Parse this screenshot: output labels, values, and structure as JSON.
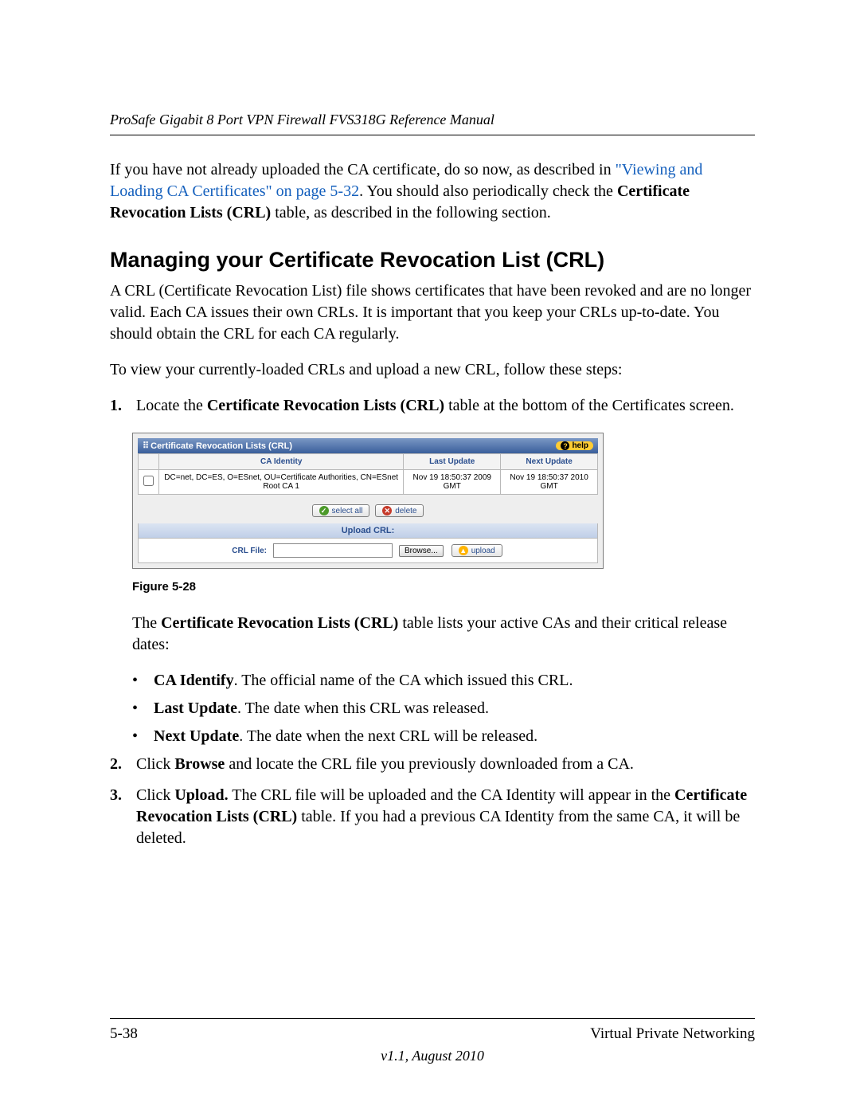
{
  "header": {
    "running": "ProSafe Gigabit 8 Port VPN Firewall FVS318G Reference Manual"
  },
  "para1": {
    "pre": "If you have not already uploaded the CA certificate, do so now, as described in ",
    "link": "\"Viewing and Loading CA Certificates\" on page 5-32",
    "post": ". You should also periodically check the ",
    "bold": "Certificate Revocation Lists (CRL)",
    "tail": " table, as described in the following section."
  },
  "heading": "Managing your Certificate Revocation List (CRL)",
  "para2": "A CRL (Certificate Revocation List) file shows certificates that have been revoked and are no longer valid. Each CA issues their own CRLs. It is important that you keep your CRLs up-to-date. You should obtain the CRL for each CA regularly.",
  "para3": "To view your currently-loaded CRLs and upload a new CRL, follow these steps:",
  "step1": {
    "num": "1.",
    "pre": "Locate the ",
    "bold": "Certificate Revocation Lists (CRL)",
    "post": " table at the bottom of the Certificates screen."
  },
  "figure": {
    "panel_title": "Certificate Revocation Lists (CRL)",
    "help": "help",
    "cols": {
      "ca": "CA Identity",
      "last": "Last Update",
      "next": "Next Update"
    },
    "row": {
      "ca": "DC=net, DC=ES, O=ESnet, OU=Certificate Authorities, CN=ESnet Root CA 1",
      "last": "Nov 19 18:50:37 2009 GMT",
      "next": "Nov 19 18:50:37 2010 GMT"
    },
    "btn_select_all": "select all",
    "btn_delete": "delete",
    "upload_header": "Upload CRL:",
    "crl_file_label": "CRL File:",
    "browse": "Browse...",
    "upload": "upload"
  },
  "caption": "Figure 5-28",
  "para4": {
    "pre": "The ",
    "bold": "Certificate Revocation Lists (CRL)",
    "post": " table lists your active CAs and their critical release dates:"
  },
  "bullets": {
    "b1": {
      "bold": "CA Identify",
      "text": ". The official name of the CA which issued this CRL."
    },
    "b2": {
      "bold": "Last Update",
      "text": ". The date when this CRL was released."
    },
    "b3": {
      "bold": "Next Update",
      "text": ". The date when the next CRL will be released."
    }
  },
  "step2": {
    "num": "2.",
    "pre": "Click ",
    "bold": "Browse",
    "post": " and locate the CRL file you previously downloaded from a CA."
  },
  "step3": {
    "num": "3.",
    "pre": "Click ",
    "bold": "Upload.",
    "mid": " The CRL file will be uploaded and the CA Identity will appear in the ",
    "bold2": "Certificate Revocation Lists (CRL)",
    "post": " table. If you had a previous CA Identity from the same CA, it will be deleted."
  },
  "footer": {
    "page": "5-38",
    "section": "Virtual Private Networking",
    "version": "v1.1, August 2010"
  }
}
